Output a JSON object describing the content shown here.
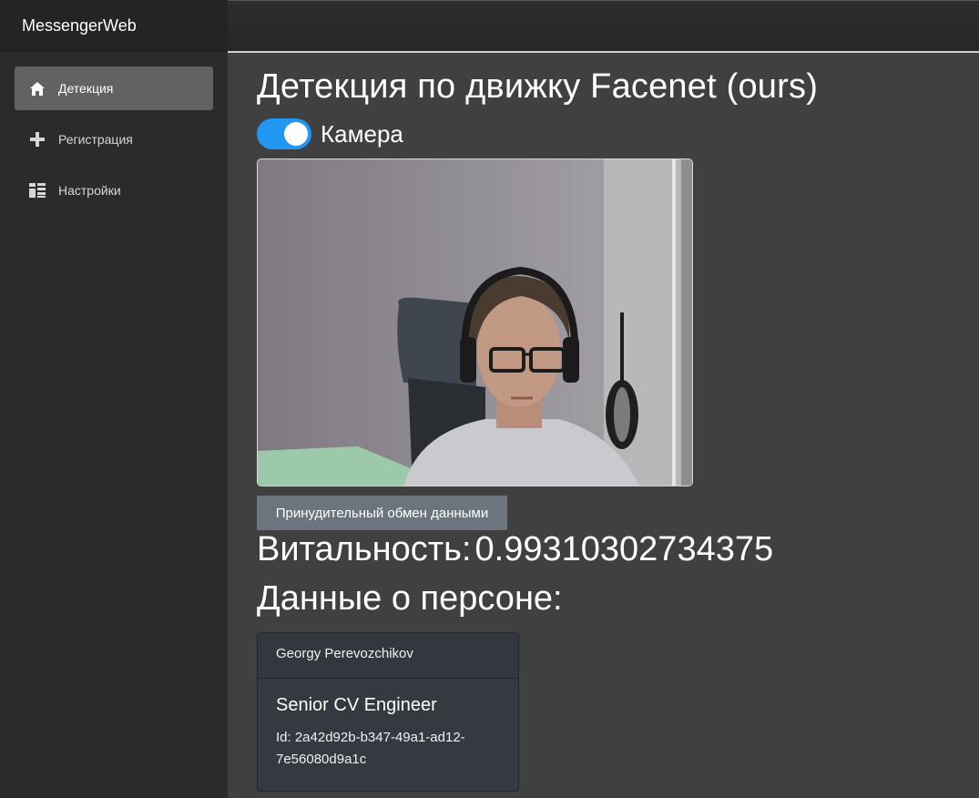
{
  "app": {
    "title": "MessengerWeb"
  },
  "sidebar": {
    "items": [
      {
        "label": "Детекция",
        "icon": "home-icon",
        "active": true
      },
      {
        "label": "Регистрация",
        "icon": "plus-icon",
        "active": false
      },
      {
        "label": "Настройки",
        "icon": "dashboard-icon",
        "active": false
      }
    ]
  },
  "main": {
    "title": "Детекция по движку Facenet (ours)",
    "camera_toggle": {
      "label": "Камера",
      "on": true
    },
    "exchange_button": "Принудительный обмен данными",
    "vitality": {
      "label": "Витальность:",
      "value": "0.99310302734375"
    },
    "person_heading": "Данные о персоне:",
    "person_card": {
      "name": "Georgy Perevozchikov",
      "position": "Senior CV Engineer",
      "id_text": "Id: 2a42d92b-b347-49a1-ad12-7e56080d9a1c"
    }
  },
  "colors": {
    "toggle_on": "#2196f3",
    "button_secondary": "#6c757d",
    "sidebar_active": "#626262"
  }
}
